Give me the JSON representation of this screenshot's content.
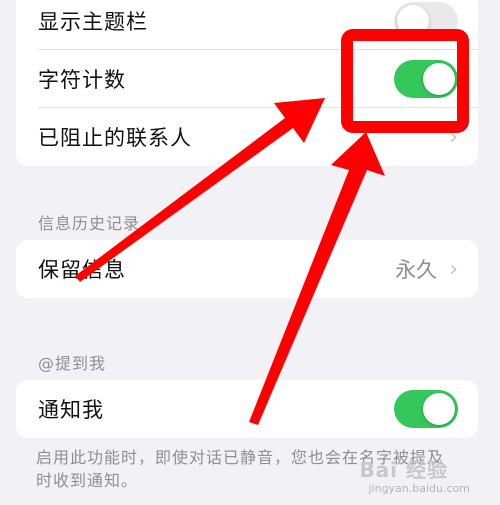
{
  "settings_group_1": {
    "rows": [
      {
        "label": "显示主题栏",
        "toggle": "off"
      },
      {
        "label": "字符计数",
        "toggle": "on"
      },
      {
        "label": "已阻止的联系人"
      }
    ]
  },
  "history_section": {
    "title": "信息历史记录",
    "row": {
      "label": "保留信息",
      "value": "永久"
    }
  },
  "mention_section": {
    "title": "@提到我",
    "row": {
      "label": "通知我",
      "toggle": "on"
    },
    "note": "启用此功能时，即使对话已静音，您也会在名字被提及时收到通知。"
  },
  "colors": {
    "toggle_on": "#34c759",
    "toggle_off": "#e9e9eb",
    "annotation_red": "#ff0000"
  },
  "watermark": {
    "mark": "Bai 经验",
    "url": "jingyan.baidu.com"
  }
}
